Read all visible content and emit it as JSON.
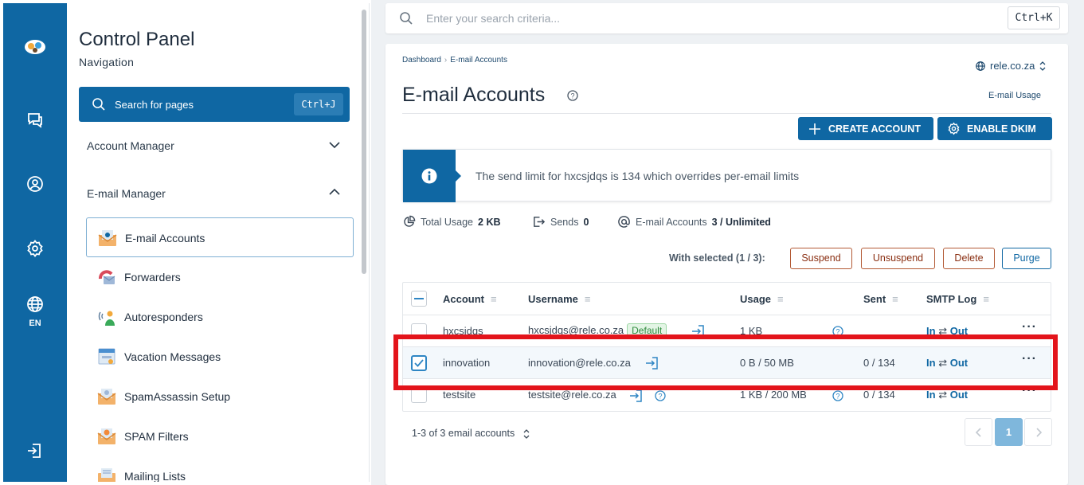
{
  "rail": {
    "language": "EN"
  },
  "nav": {
    "title": "Control Panel",
    "subtitle": "Navigation",
    "search_label": "Search for pages",
    "search_shortcut": "Ctrl+J",
    "sections": [
      {
        "label": "Account Manager",
        "expanded": false
      },
      {
        "label": "E-mail Manager",
        "expanded": true
      }
    ],
    "items": [
      {
        "label": "E-mail Accounts",
        "icon": "email-accounts-icon",
        "active": true
      },
      {
        "label": "Forwarders",
        "icon": "forwarders-icon"
      },
      {
        "label": "Autoresponders",
        "icon": "autoresponders-icon"
      },
      {
        "label": "Vacation Messages",
        "icon": "vacation-messages-icon"
      },
      {
        "label": "SpamAssassin Setup",
        "icon": "spamassassin-icon"
      },
      {
        "label": "SPAM Filters",
        "icon": "spam-filters-icon"
      },
      {
        "label": "Mailing Lists",
        "icon": "mailing-lists-icon"
      }
    ]
  },
  "topsearch": {
    "placeholder": "Enter your search criteria...",
    "shortcut": "Ctrl+K"
  },
  "page": {
    "breadcrumb": [
      "Dashboard",
      "E-mail Accounts"
    ],
    "domain": "rele.co.za",
    "title": "E-mail Accounts",
    "usage_link": "E-mail Usage",
    "create_button": "CREATE ACCOUNT",
    "dkim_button": "ENABLE DKIM",
    "alert": "The send limit for hxcsjdqs is 134 which overrides per-email limits"
  },
  "stats": {
    "total_usage_label": "Total Usage",
    "total_usage_value": "2 KB",
    "sends_label": "Sends",
    "sends_value": "0",
    "accounts_label": "E-mail Accounts",
    "accounts_value": "3 / Unlimited"
  },
  "bulk": {
    "label": "With selected (1 / 3):",
    "suspend": "Suspend",
    "unsuspend": "Unsuspend",
    "delete": "Delete",
    "purge": "Purge"
  },
  "table": {
    "columns": [
      "Account",
      "Username",
      "Usage",
      "Sent",
      "SMTP Log"
    ],
    "rows": [
      {
        "account": "hxcsjdqs",
        "username": "hxcsjdqs@rele.co.za",
        "badge": "Default",
        "usage": "1 KB",
        "sent": "",
        "smtp_in": "In",
        "smtp_out": "Out",
        "selected": false
      },
      {
        "account": "innovation",
        "username": "innovation@rele.co.za",
        "badge": "",
        "usage": "0 B / 50 MB",
        "sent": "0 / 134",
        "smtp_in": "In",
        "smtp_out": "Out",
        "selected": true
      },
      {
        "account": "testsite",
        "username": "testsite@rele.co.za",
        "badge": "",
        "usage": "1 KB / 200 MB",
        "sent": "0 / 134",
        "smtp_in": "In",
        "smtp_out": "Out",
        "selected": false
      }
    ]
  },
  "pager": {
    "summary": "1-3 of 3 email accounts",
    "current_page": "1"
  },
  "colors": {
    "brand": "#0f67a3",
    "highlight": "#e3141b"
  }
}
